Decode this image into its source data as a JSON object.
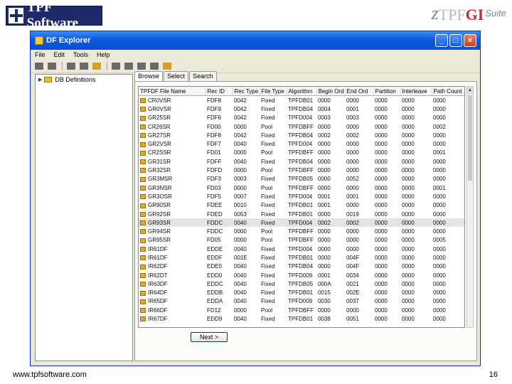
{
  "slide": {
    "logo_left": "TPF Software",
    "logo_right": {
      "z": "z",
      "tpf": "TPF",
      "gi": "GI",
      "suite": "Suite"
    },
    "footer_url": "www.tpfsoftware.com",
    "page_number": "16"
  },
  "window": {
    "title": "DF Explorer",
    "menu": [
      "File",
      "Edit",
      "Tools",
      "Help"
    ],
    "toolbar_icons": [
      "play-icon",
      "pause-icon",
      "find-icon",
      "cut-icon",
      "copy-icon",
      "paste-icon",
      "export-icon",
      "delete-icon",
      "refresh-icon",
      "settings-icon"
    ],
    "tree": {
      "item_label": "DB Definitions"
    },
    "tabs": [
      "Browse",
      "Select",
      "Search"
    ],
    "active_tab": "Browse",
    "next_button": "Next >"
  },
  "table": {
    "columns": [
      "TPFDF File Name",
      "Rec ID",
      "Rec Type",
      "File Type",
      "Algorithm",
      "Begin Ord",
      "End Ord",
      "Partition",
      "Interleave",
      "Path Count"
    ],
    "rows": [
      [
        "CR0VSR",
        "FDF8",
        "0042",
        "Fixed",
        "TPFDB01",
        "0000",
        "0000",
        "0000",
        "0000",
        "0000"
      ],
      [
        "GR0VSR",
        "FDF9",
        "0042",
        "Fixed",
        "TPFDB04",
        "0004",
        "0001",
        "0000",
        "0000",
        "0000"
      ],
      [
        "GR25SR",
        "FDF6",
        "0042",
        "Fixed",
        "TPFD004",
        "0003",
        "0003",
        "0000",
        "0000",
        "0000"
      ],
      [
        "CR26SR",
        "FD00",
        "0000",
        "Pool",
        "TPFDBFF",
        "0000",
        "0000",
        "0000",
        "0000",
        "0002"
      ],
      [
        "GR27SR",
        "FDF8",
        "0042",
        "Fixed",
        "TPFDB04",
        "0002",
        "0002",
        "0000",
        "0000",
        "0000"
      ],
      [
        "GR2VSR",
        "FDF7",
        "0040",
        "Fixed",
        "TPFD004",
        "0000",
        "0000",
        "0000",
        "0000",
        "0000"
      ],
      [
        "CR2SSR",
        "FD01",
        "0000",
        "Pool",
        "TPFDBFF",
        "0000",
        "0000",
        "0000",
        "0000",
        "0001"
      ],
      [
        "GR31SR",
        "FDFF",
        "0040",
        "Fixed",
        "TPFDB04",
        "0000",
        "0000",
        "0000",
        "0000",
        "0000"
      ],
      [
        "GR32SR",
        "FDFD",
        "0000",
        "Pool",
        "TPFDBFF",
        "0000",
        "0000",
        "0000",
        "0000",
        "0000"
      ],
      [
        "GR3MSR",
        "FDF3",
        "0003",
        "Fixed",
        "TPFDB05",
        "0000",
        "0052",
        "0000",
        "0000",
        "0000"
      ],
      [
        "GR3NSR",
        "FD03",
        "0000",
        "Pool",
        "TPFDBFF",
        "0000",
        "0000",
        "0000",
        "0000",
        "0001"
      ],
      [
        "GR3OSR",
        "FDF5",
        "0007",
        "Fixed",
        "TPFD004",
        "0001",
        "0001",
        "0000",
        "0000",
        "0000"
      ],
      [
        "GR90SR",
        "FDEE",
        "0010",
        "Fixed",
        "TPFDB01",
        "0001",
        "0000",
        "0000",
        "0000",
        "0000"
      ],
      [
        "GR92SR",
        "FDED",
        "0053",
        "Fixed",
        "TPFDB01",
        "0000",
        "0019",
        "0000",
        "0000",
        "0000"
      ],
      [
        "GR93SR",
        "FDDC",
        "0040",
        "Fixed",
        "TPFD004",
        "0002",
        "0002",
        "0000",
        "0000",
        "0000"
      ],
      [
        "GR94SR",
        "FDDC",
        "0000",
        "Pool",
        "TPFDBFF",
        "0000",
        "0000",
        "0000",
        "0000",
        "0000"
      ],
      [
        "GR95SR",
        "FD05",
        "0000",
        "Pool",
        "TPFDBFF",
        "0000",
        "0000",
        "0000",
        "0000",
        "0005"
      ],
      [
        "IR61DF",
        "EDDE",
        "0040",
        "Fixed",
        "TPFD004",
        "0000",
        "0000",
        "0000",
        "0000",
        "0000"
      ],
      [
        "IR61DF",
        "EDDF",
        "001E",
        "Fixed",
        "TPFDB01",
        "0000",
        "004F",
        "0000",
        "0000",
        "0000"
      ],
      [
        "IR62DF",
        "EDE0",
        "0040",
        "Fixed",
        "TPFDB04",
        "0000",
        "004F",
        "0000",
        "0000",
        "0000"
      ],
      [
        "IR62DT",
        "EDD0",
        "0040",
        "Fixed",
        "TPFD009",
        "0001",
        "0034",
        "0000",
        "0000",
        "0000"
      ],
      [
        "IR63DF",
        "EDDC",
        "0040",
        "Fixed",
        "TPFDB05",
        "000A",
        "0021",
        "0000",
        "0000",
        "0000"
      ],
      [
        "IR64DF",
        "EDDB",
        "0040",
        "Fixed",
        "TPFDB01",
        "0015",
        "002E",
        "0000",
        "0000",
        "0000"
      ],
      [
        "IR65DF",
        "EDDA",
        "0040",
        "Fixed",
        "TPFD009",
        "0030",
        "0037",
        "0000",
        "0000",
        "0000"
      ],
      [
        "IR66DF",
        "FD12",
        "0000",
        "Pool",
        "TPFDBFF",
        "0000",
        "0000",
        "0000",
        "0000",
        "0000"
      ],
      [
        "IR67DF",
        "EDD9",
        "0040",
        "Fixed",
        "TPFDB01",
        "0038",
        "0051",
        "0000",
        "0000",
        "0000"
      ]
    ],
    "selected_row_index": 14
  }
}
